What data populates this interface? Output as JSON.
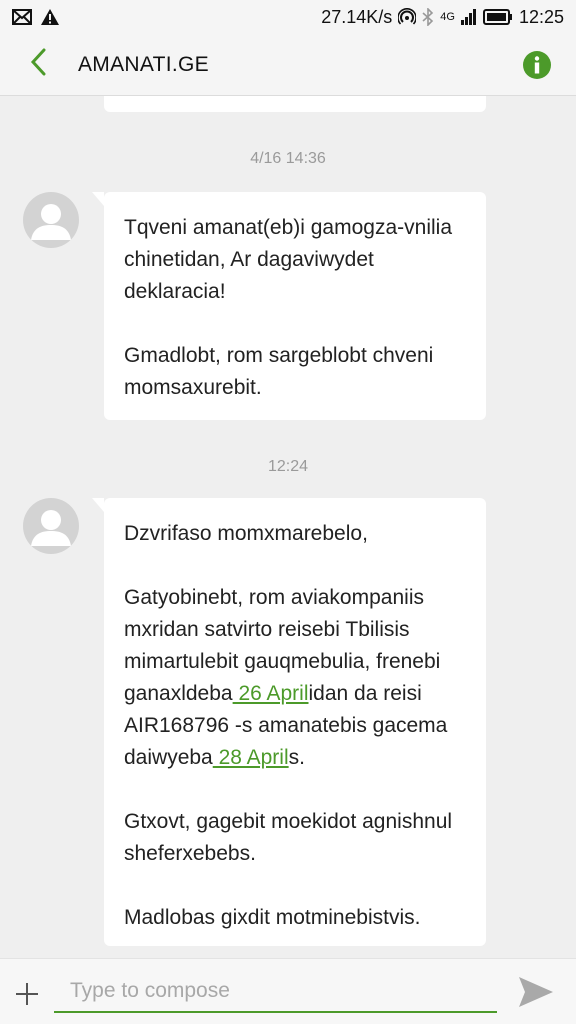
{
  "status_bar": {
    "net_speed": "27.14K/s",
    "network_type": "4G",
    "time": "12:25",
    "icons": [
      "mail-icon",
      "warning-icon",
      "hotspot-icon",
      "bluetooth-icon",
      "signal-icon",
      "battery-icon"
    ]
  },
  "header": {
    "title": "AMANATI.GE",
    "back_icon": "back-chevron-icon",
    "info_icon": "info-icon",
    "accent": "#4c9a2a"
  },
  "messages": [
    {
      "timestamp": "4/16 14:36",
      "paragraphs": [
        [
          "Tqveni amanat(eb)i gamogza-vnilia chinetidan, Ar dagaviwydet deklaracia!"
        ],
        [
          "Gmadlobt, rom sargeblobt chveni momsaxurebit."
        ]
      ]
    },
    {
      "timestamp": "12:24",
      "greeting": "Dzvrifaso momxmarebelo,",
      "body_part1": "Gatyobinebt, rom aviakompaniis mxridan satvirto reisebi Tbilisis mimartulebit gauqmebulia, frenebi ganaxldeba",
      "link1": " 26 April",
      "body_part2": "idan da reisi AIR168796 -s amanatebis gacema daiwyeba",
      "link2": " 28 April",
      "body_part3": "s.",
      "para3": "Gtxovt, gagebit moekidot agnishnul sheferxebebs.",
      "para4": "Madlobas gixdit motminebistvis."
    }
  ],
  "compose": {
    "placeholder": "Type to compose",
    "add_icon": "plus-icon",
    "send_icon": "send-icon"
  }
}
